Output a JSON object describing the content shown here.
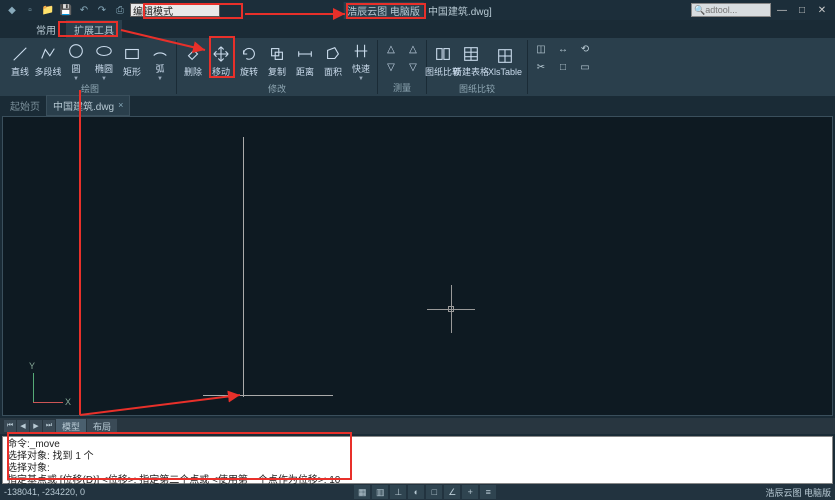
{
  "title": {
    "product": "浩辰云图 电脑版",
    "file_suffix": "中国建筑.dwg]",
    "input_label": "编辑模式"
  },
  "search_placeholder": "adtool...",
  "tabs": {
    "common": "常用",
    "extend": "扩展工具"
  },
  "ribbon": {
    "draw": {
      "label": "绘图",
      "btns": [
        "直线",
        "多段线",
        "圆",
        "椭圆",
        "矩形",
        "弧"
      ]
    },
    "modify": {
      "label": "修改",
      "btns": [
        "删除",
        "移动",
        "旋转",
        "复制",
        "距离",
        "面积",
        "快速"
      ]
    },
    "measure": {
      "label": "测量"
    },
    "layer": {
      "label": "图纸比较",
      "btns": [
        "图纸比较",
        "新建表格",
        "XlsTable"
      ]
    },
    "small_icons": [
      "◫",
      "↔",
      "⟲",
      "✂",
      "□",
      "▭"
    ]
  },
  "filetabs": {
    "start": "起始页",
    "active": "中国建筑.dwg"
  },
  "ucs": {
    "x": "X",
    "y": "Y"
  },
  "layout": {
    "model": "模型",
    "sheet": "布局"
  },
  "cmd": {
    "l1": "命令:_move",
    "l2": "选择对象: 找到 1 个",
    "l3": "选择对象:",
    "l4": "指定基点或 [位移(D)] <位移>:   指定第二个点或 <使用第一个点作为位移>: 10"
  },
  "status": {
    "coords": "-138041, -234220, 0",
    "right": "浩辰云图 电脑版"
  }
}
